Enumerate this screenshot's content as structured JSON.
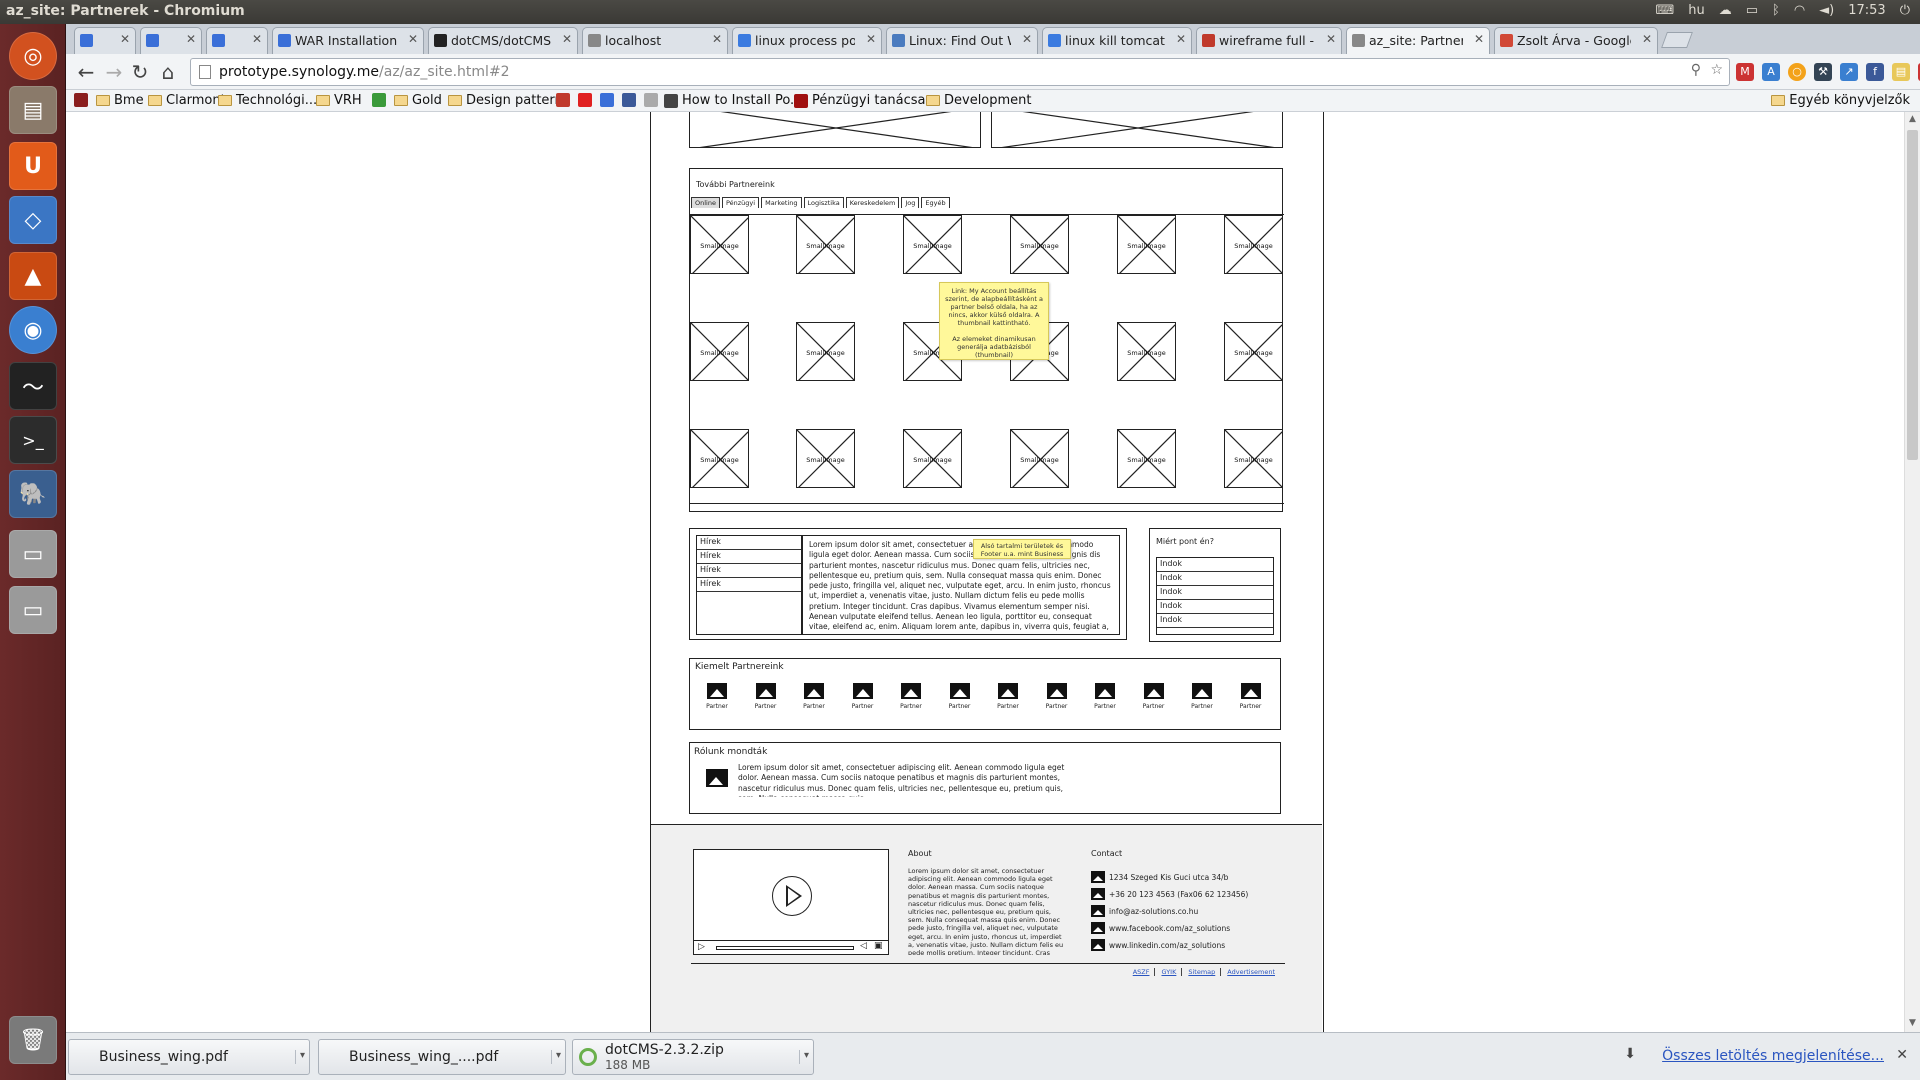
{
  "system": {
    "window_title": "az_site: Partnerek - Chromium",
    "keyboard": "hu",
    "time": "17:53",
    "user": "Zsolt Árva"
  },
  "launcher": [
    "ubuntu-logo-icon",
    "files-icon",
    "ubuntu-one-icon",
    "virtualbox-icon",
    "vlc-icon",
    "chromium-icon",
    "system-monitor-icon",
    "terminal-icon",
    "postgresql-icon",
    "drive-icon",
    "drive-2-icon",
    "trash-icon"
  ],
  "tabs": [
    {
      "label": "",
      "color": "#3a6fd8"
    },
    {
      "label": "",
      "color": "#3a6fd8"
    },
    {
      "label": "",
      "color": "#3a6fd8"
    },
    {
      "label": "WAR Installation - dotCMS",
      "color": "#3a6fd8"
    },
    {
      "label": "dotCMS/dotCMS",
      "color": "#222222"
    },
    {
      "label": "localhost",
      "color": "#888888"
    },
    {
      "label": "linux process port numb",
      "color": "#3b7be0"
    },
    {
      "label": "Linux: Find Out Which P",
      "color": "#4a7bbf"
    },
    {
      "label": "linux kill tomcat - Googl",
      "color": "#3b7be0"
    },
    {
      "label": "wireframe full - laszlo.h",
      "color": "#c0392b"
    },
    {
      "label": "az_site: Partnerek",
      "color": "#888888"
    },
    {
      "label": "Zsolt Árva - Google+",
      "color": "#d14836"
    }
  ],
  "toolbar": {
    "url_host": "prototype.synology.me",
    "url_path": "/az/az_site.html#2"
  },
  "bookmarks": [
    {
      "label": "",
      "type": "icon",
      "color": "#8a1e1e"
    },
    {
      "label": "Bme",
      "type": "folder"
    },
    {
      "label": "Clarmont",
      "type": "folder"
    },
    {
      "label": "Technológi...",
      "type": "folder"
    },
    {
      "label": "VRH",
      "type": "folder"
    },
    {
      "label": "",
      "type": "icon",
      "color": "#3a9a3a"
    },
    {
      "label": "Gold",
      "type": "folder"
    },
    {
      "label": "Design patterns",
      "type": "folder"
    },
    {
      "label": "",
      "type": "icon",
      "color": "#c0392b"
    },
    {
      "label": "",
      "type": "icon",
      "color": "#e02020"
    },
    {
      "label": "",
      "type": "icon",
      "color": "#3a6fd8"
    },
    {
      "label": "",
      "type": "icon",
      "color": "#3b5998"
    },
    {
      "label": "",
      "type": "icon",
      "color": "#aaaaaa"
    },
    {
      "label": "How to Install Po...",
      "type": "icon",
      "color": "#444444"
    },
    {
      "label": "Pénzügyi tanácsa...",
      "type": "icon",
      "color": "#a01010"
    },
    {
      "label": "Development",
      "type": "folder"
    }
  ],
  "other_bookmarks": "Egyéb könyvjelzők",
  "wireframe": {
    "more_partners_title": "További Partnereink",
    "subtabs": [
      "Online",
      "Pénzügyi",
      "Marketing",
      "Logisztika",
      "Kereskedelem",
      "Jog",
      "Egyéb"
    ],
    "small_image_label": "SmallImage",
    "sticky1": "Link: My Account beállítás szerint, de alapbeállításként a partner belső oldala, ha az nincs, akkor külső oldalra. A thumbnail kattintható.\n\nAz elemeket dinamikusan generálja adatbázisból (thumbnail)",
    "news_items": [
      "Hírek",
      "Hírek",
      "Hírek",
      "Hírek"
    ],
    "news_text": "Lorem ipsum dolor sit amet, consectetuer adipiscing elit. Aenean commodo ligula eget dolor. Aenean massa. Cum sociis natoque penatibus et magnis dis parturient montes, nascetur ridiculus mus. Donec quam felis, ultricies nec, pellentesque eu, pretium quis, sem. Nulla consequat massa quis enim. Donec pede justo, fringilla vel, aliquet nec, vulputate eget, arcu. In enim justo, rhoncus ut, imperdiet a, venenatis vitae, justo. Nullam dictum felis eu pede mollis pretium. Integer tincidunt. Cras dapibus. Vivamus elementum semper nisi. Aenean vulputate eleifend tellus. Aenean leo ligula, porttitor eu, consequat vitae, eleifend ac, enim. Aliquam lorem ante, dapibus in, viverra quis, feugiat a, tellus. Phasellus viverra nulla ut metus varius laoreet. Quisque rutrum. Aenean",
    "sticky2": "Alsó tartalmi területek és Footer u.a. mint Business",
    "why_title": "Miért pont én?",
    "why_items": [
      "Indok",
      "Indok",
      "Indok",
      "Indok",
      "Indok"
    ],
    "featured_title": "Kiemelt Partnereink",
    "partner_label": "Partner",
    "testimonial_title": "Rólunk mondták",
    "testimonial_text": "Lorem ipsum dolor sit amet, consectetuer adipiscing elit. Aenean commodo ligula eget dolor. Aenean massa. Cum sociis natoque penatibus et magnis dis parturient montes, nascetur ridiculus mus. Donec quam felis, ultricies nec, pellentesque eu, pretium quis, sem. Nulla consequat massa quis",
    "about_title": "About",
    "about_text": "Lorem ipsum dolor sit amet, consectetuer adipiscing elit. Aenean commodo ligula eget dolor. Aenean massa. Cum sociis natoque penatibus et magnis dis parturient montes, nascetur ridiculus mus. Donec quam felis, ultricies nec, pellentesque eu, pretium quis, sem. Nulla consequat massa quis enim. Donec pede justo, fringilla vel, aliquet nec, vulputate eget, arcu. In enim justo, rhoncus ut, imperdiet a, venenatis vitae, justo. Nullam dictum felis eu pede mollis pretium. Integer tincidunt. Cras dapibus. Vivamus elementum semper nisi. Aenean vulputate eleifend tellus. Aenean leo ligula, porttitor eu, consequat vitae, eleifend ac, enim. Aliquam lorem ante, dapibus in, viverra quis",
    "contact_title": "Contact",
    "contacts": [
      "1234 Szeged Kis Guci utca 34/b",
      "+36 20 123 4563 (Fax06 62 123456)",
      "info@az-solutions.co.hu",
      "www.facebook.com/az_solutions",
      "www.linkedin.com/az_solutions"
    ],
    "footer_links": [
      "ASZF",
      "GYIK",
      "Sitemap",
      "Advertisement"
    ]
  },
  "downloads": {
    "items": [
      {
        "name": "Business_wing.pdf",
        "size": ""
      },
      {
        "name": "Business_wing_....pdf",
        "size": ""
      },
      {
        "name": "dotCMS-2.3.2.zip",
        "size": "188 MB"
      }
    ],
    "show_all": "Összes letöltés megjelenítése..."
  }
}
